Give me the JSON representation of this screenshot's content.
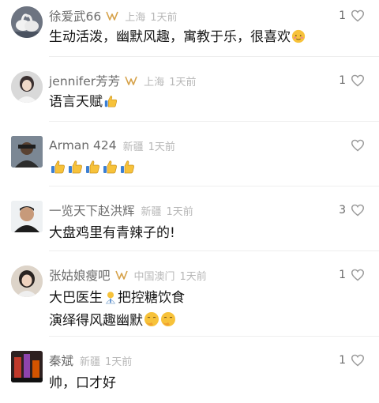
{
  "comments": [
    {
      "name": "徐爱武66",
      "location": "上海",
      "time": "1天前",
      "likes": "1",
      "badge": "gold-v-badge-icon",
      "lines": [
        "生动活泼，幽默风趣，寓教于乐，很喜欢"
      ],
      "line_emojis": [
        "blushing-face-icon"
      ]
    },
    {
      "name": "jennifer芳芳",
      "location": "上海",
      "time": "1天前",
      "likes": "1",
      "badge": "gold-v-badge-icon",
      "lines": [
        "语言天赋"
      ],
      "line_emojis": [
        "thumbs-up-icon"
      ]
    },
    {
      "name": "Arman 424",
      "location": "新疆",
      "time": "1天前",
      "likes": "",
      "lines": [
        ""
      ],
      "thumbs_count": 5
    },
    {
      "name": "一览天下赵洪辉",
      "location": "新疆",
      "time": "1天前",
      "likes": "3",
      "lines": [
        "大盘鸡里有青辣子的!"
      ]
    },
    {
      "name": "张姑娘瘦吧",
      "location": "中国澳门",
      "time": "1天前",
      "likes": "1",
      "badge": "gold-v-badge-icon",
      "lines": [
        "大巴医生",
        "把控糖饮食",
        "演绎得风趣幽默"
      ],
      "line_emojis": [
        "doctor-icon",
        "smirk-face-icon",
        "smirk-face-icon"
      ]
    },
    {
      "name": "秦斌",
      "location": "新疆",
      "time": "1天前",
      "likes": "1",
      "lines": [
        "帅，口才好"
      ]
    }
  ],
  "colors": {
    "badge_gold": "#d6a24a",
    "name": "#6b6b6b",
    "meta": "#b7b7b7",
    "thumb_yellow": "#f7c23a"
  }
}
